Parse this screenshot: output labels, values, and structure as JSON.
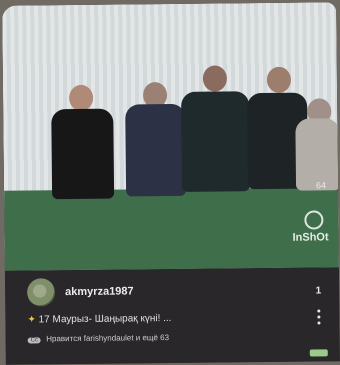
{
  "video": {
    "overlay_count": "64",
    "watermark": "InShOt"
  },
  "post": {
    "username": "akmyrza1987",
    "right_count": "1",
    "caption_prefix": "✦",
    "caption_text": "17 Маурыз- Шаңырақ күні! ...",
    "likes_badge": "Cc",
    "likes_text": "Нравится farishyndaulet и ещё 63"
  }
}
